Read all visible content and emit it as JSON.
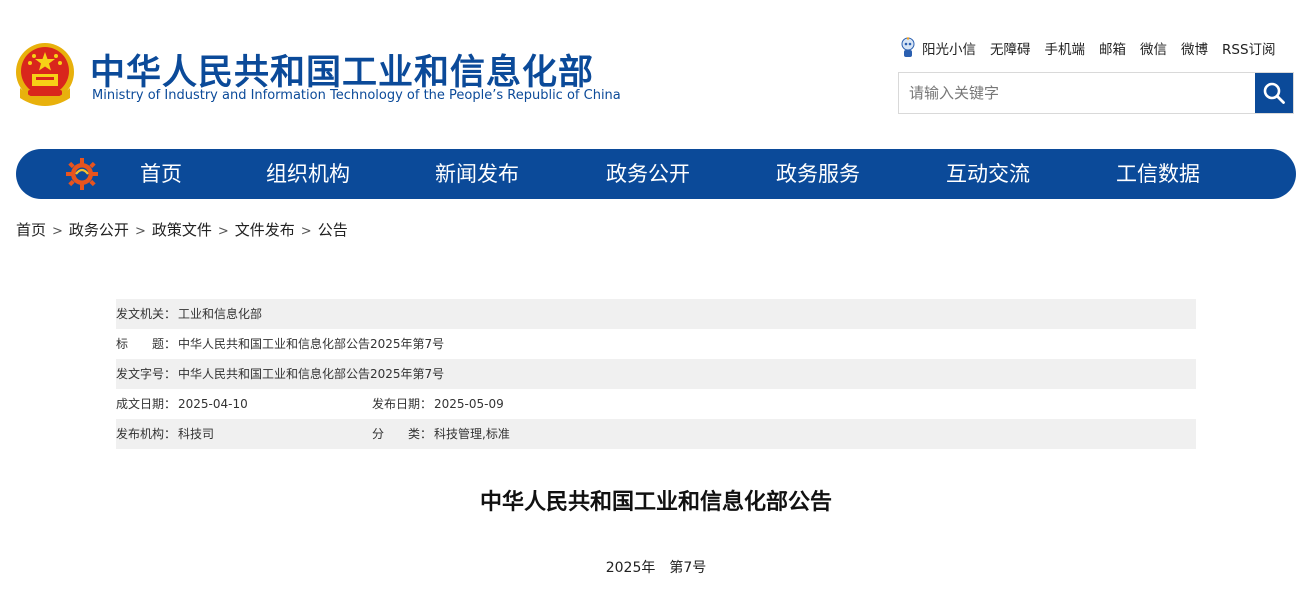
{
  "header": {
    "title": "中华人民共和国工业和信息化部",
    "subtitle": "Ministry of Industry and Information Technology of the People’s Republic of China",
    "links": [
      "阳光小信",
      "无障碍",
      "手机端",
      "邮箱",
      "微信",
      "微博",
      "RSS订阅"
    ],
    "search": {
      "placeholder": "请输入关键字",
      "value": ""
    },
    "brand_color": "#0b4a99"
  },
  "nav": {
    "items": [
      "首页",
      "组织机构",
      "新闻发布",
      "政务公开",
      "政务服务",
      "互动交流",
      "工信数据"
    ]
  },
  "breadcrumb": [
    "首页",
    "政务公开",
    "政策文件",
    "文件发布",
    "公告"
  ],
  "meta": {
    "issuer_label": "发文机关：",
    "issuer": "工业和信息化部",
    "title_label": "标　　题：",
    "title": "中华人民共和国工业和信息化部公告2025年第7号",
    "doc_no_label": "发文字号：",
    "doc_no": "中华人民共和国工业和信息化部公告2025年第7号",
    "created_label": "成文日期：",
    "created": "2025-04-10",
    "published_label": "发布日期：",
    "published": "2025-05-09",
    "org_label": "发布机构：",
    "org": "科技司",
    "category_label": "分　　类：",
    "category": "科技管理,标准"
  },
  "document": {
    "title": "中华人民共和国工业和信息化部公告",
    "number": "2025年　第7号"
  }
}
